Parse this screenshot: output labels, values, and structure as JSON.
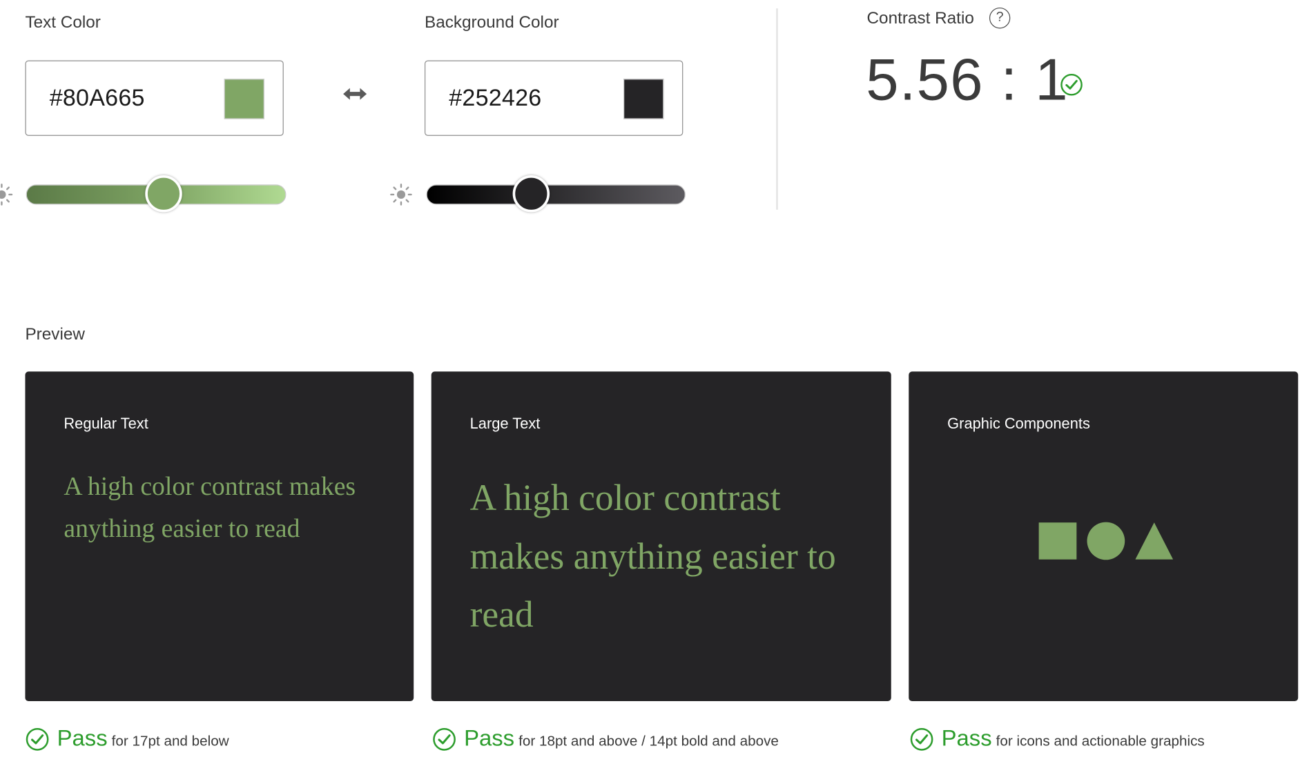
{
  "text_color": {
    "label": "Text Color",
    "hex": "#80A665",
    "slider_value": 0.53
  },
  "swap_button": {
    "icon": "swap-arrows-icon"
  },
  "background_color": {
    "label": "Background Color",
    "hex": "#252426",
    "slider_value": 0.41
  },
  "contrast": {
    "label": "Contrast Ratio",
    "help_icon": "?",
    "value": "5.56 : 1",
    "status_icon": "check-circle-icon"
  },
  "preview": {
    "label": "Preview",
    "cards": [
      {
        "title": "Regular Text",
        "sample": "A high color contrast makes anything easier to read"
      },
      {
        "title": "Large Text",
        "sample": "A high color contrast makes anything easier to read"
      },
      {
        "title": "Graphic Components",
        "shapes": [
          "square",
          "circle",
          "triangle"
        ]
      }
    ]
  },
  "results": [
    {
      "status": "Pass",
      "description": "for 17pt and below"
    },
    {
      "status": "Pass",
      "description": "for 18pt and above / 14pt bold and above"
    },
    {
      "status": "Pass",
      "description": "for icons and actionable graphics"
    }
  ],
  "colors": {
    "foreground": "#80A665",
    "background": "#252426",
    "pass_green": "#2D9D2D"
  }
}
